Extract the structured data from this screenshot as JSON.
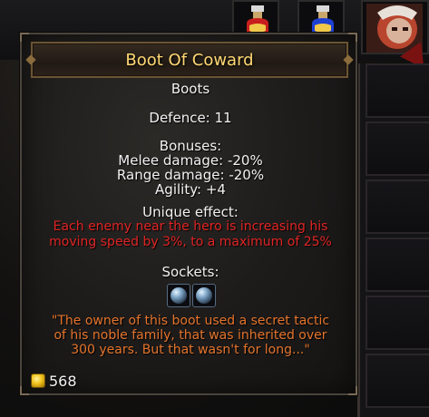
{
  "tooltip": {
    "title": "Boot Of Coward",
    "item_type": "Boots",
    "defence": "Defence: 11",
    "bonuses_header": "Bonuses:",
    "bonuses": [
      "Melee damage: -20%",
      "Range damage: -20%",
      "Agility: +4"
    ],
    "unique_header": "Unique effect:",
    "unique_lines": [
      "Each enemy near the hero is increasing his",
      "moving speed by 3%, to a maximum of 25%"
    ],
    "sockets_header": "Sockets:",
    "socket_count": 2,
    "lore_lines": [
      "\"The owner of this boot used a secret tactic",
      "of his noble family, that was inherited over",
      "300 years. But that wasn't for long...\""
    ],
    "gold": "568"
  },
  "colors": {
    "title": "#ffd873",
    "text": "#f2f2f2",
    "unique": "#e02424",
    "lore": "#e4742c"
  },
  "icons": {
    "gold": "gold-coin-icon",
    "socket": "empty-socket-icon"
  }
}
